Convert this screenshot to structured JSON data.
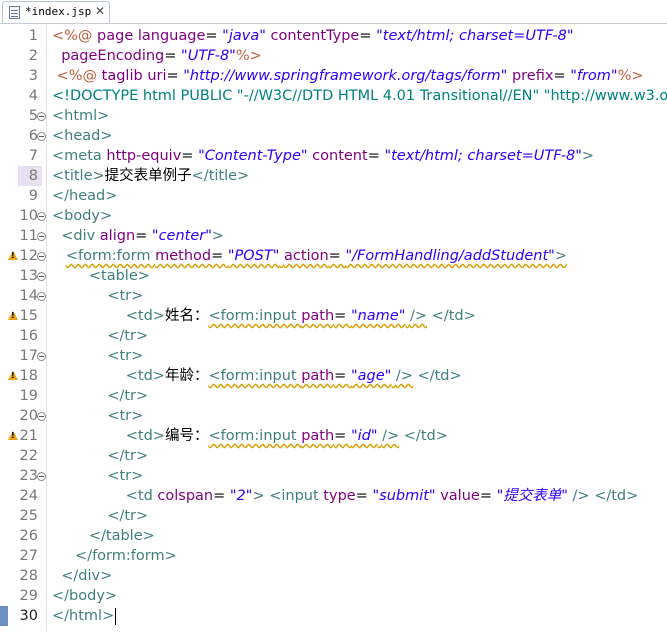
{
  "tab": {
    "title": "*index.jsp",
    "close": "✕",
    "icon": "jsp-file-icon"
  },
  "editor": {
    "current_line": 30,
    "fold_lines": [
      5,
      6,
      10,
      11,
      12,
      13,
      14,
      17,
      20,
      23
    ],
    "warning_lines": [
      12,
      15,
      18,
      21
    ],
    "highlight_lines": [
      8
    ],
    "bookmark_lines": [
      30
    ],
    "lines": [
      [
        [
          "jsp",
          "<%@ "
        ],
        [
          "attr",
          "page "
        ],
        [
          "attr",
          "language"
        ],
        [
          "text",
          "= "
        ],
        [
          "val",
          "\"java\""
        ],
        [
          "text",
          " "
        ],
        [
          "attr",
          "contentType"
        ],
        [
          "text",
          "= "
        ],
        [
          "val",
          "\"text/html; charset=UTF-8\""
        ]
      ],
      [
        [
          "text",
          "  "
        ],
        [
          "attr",
          "pageEncoding"
        ],
        [
          "text",
          "= "
        ],
        [
          "val",
          "\"UTF-8\""
        ],
        [
          "jsp",
          "%>"
        ]
      ],
      [
        [
          "jsp",
          " <%@ "
        ],
        [
          "attr",
          "taglib "
        ],
        [
          "attr",
          "uri"
        ],
        [
          "text",
          "= "
        ],
        [
          "val",
          "\"http://www.springframework.org/tags/form\""
        ],
        [
          "text",
          " "
        ],
        [
          "attr",
          "prefix"
        ],
        [
          "text",
          "= "
        ],
        [
          "val",
          "\"from\""
        ],
        [
          "jsp",
          "%>"
        ]
      ],
      [
        [
          "doc",
          "<!DOCTYPE html PUBLIC \"-//W3C//DTD HTML 4.01 Transitional//EN\" \"http://www.w3.or"
        ]
      ],
      [
        [
          "tag",
          "<html>"
        ]
      ],
      [
        [
          "tag",
          "<head>"
        ]
      ],
      [
        [
          "tag",
          "<meta "
        ],
        [
          "attr",
          "http-equiv"
        ],
        [
          "text",
          "= "
        ],
        [
          "val",
          "\"Content-Type\""
        ],
        [
          "text",
          " "
        ],
        [
          "attr",
          "content"
        ],
        [
          "text",
          "= "
        ],
        [
          "val",
          "\"text/html; charset=UTF-8\""
        ],
        [
          "tag",
          ">"
        ]
      ],
      [
        [
          "tag",
          "<title>"
        ],
        [
          "text",
          "提交表单例子"
        ],
        [
          "tag",
          "</title>"
        ]
      ],
      [
        [
          "tag",
          "</head>"
        ]
      ],
      [
        [
          "tag",
          "<body>"
        ]
      ],
      [
        [
          "text",
          "  "
        ],
        [
          "tag",
          "<div "
        ],
        [
          "attr",
          "align"
        ],
        [
          "text",
          "= "
        ],
        [
          "val",
          "\"center\""
        ],
        [
          "tag",
          ">"
        ]
      ],
      [
        [
          "text",
          "   "
        ],
        [
          "sq_tag",
          "<form:form "
        ],
        [
          "sq_attr",
          "method"
        ],
        [
          "sq_text",
          "= "
        ],
        [
          "sq_val",
          "\"POST\""
        ],
        [
          "sq_text",
          " "
        ],
        [
          "sq_attr",
          "action"
        ],
        [
          "sq_text",
          "= "
        ],
        [
          "sq_val",
          "\"/FormHandling/addStudent\""
        ],
        [
          "sq_tag",
          ">"
        ]
      ],
      [
        [
          "text",
          "        "
        ],
        [
          "tag",
          "<table>"
        ]
      ],
      [
        [
          "text",
          "            "
        ],
        [
          "tag",
          "<tr>"
        ]
      ],
      [
        [
          "text",
          "                "
        ],
        [
          "tag",
          "<td>"
        ],
        [
          "text",
          "姓名："
        ],
        [
          "sq_tag",
          "<form:input "
        ],
        [
          "sq_attr",
          "path"
        ],
        [
          "sq_text",
          "= "
        ],
        [
          "sq_val",
          "\"name\""
        ],
        [
          "sq_text",
          " "
        ],
        [
          "sq_tag",
          "/>"
        ],
        [
          "text",
          " "
        ],
        [
          "tag",
          "</td>"
        ]
      ],
      [
        [
          "text",
          "            "
        ],
        [
          "tag",
          "</tr>"
        ]
      ],
      [
        [
          "text",
          "            "
        ],
        [
          "tag",
          "<tr>"
        ]
      ],
      [
        [
          "text",
          "                "
        ],
        [
          "tag",
          "<td>"
        ],
        [
          "text",
          "年龄："
        ],
        [
          "sq_tag",
          "<form:input "
        ],
        [
          "sq_attr",
          "path"
        ],
        [
          "sq_text",
          "= "
        ],
        [
          "sq_val",
          "\"age\""
        ],
        [
          "sq_text",
          " "
        ],
        [
          "sq_tag",
          "/>"
        ],
        [
          "text",
          " "
        ],
        [
          "tag",
          "</td>"
        ]
      ],
      [
        [
          "text",
          "            "
        ],
        [
          "tag",
          "</tr>"
        ]
      ],
      [
        [
          "text",
          "            "
        ],
        [
          "tag",
          "<tr>"
        ]
      ],
      [
        [
          "text",
          "                "
        ],
        [
          "tag",
          "<td>"
        ],
        [
          "text",
          "编号："
        ],
        [
          "sq_tag",
          "<form:input "
        ],
        [
          "sq_attr",
          "path"
        ],
        [
          "sq_text",
          "= "
        ],
        [
          "sq_val",
          "\"id\""
        ],
        [
          "sq_text",
          " "
        ],
        [
          "sq_tag",
          "/>"
        ],
        [
          "text",
          " "
        ],
        [
          "tag",
          "</td>"
        ]
      ],
      [
        [
          "text",
          "            "
        ],
        [
          "tag",
          "</tr>"
        ]
      ],
      [
        [
          "text",
          "            "
        ],
        [
          "tag",
          "<tr>"
        ]
      ],
      [
        [
          "text",
          "                "
        ],
        [
          "tag",
          "<td "
        ],
        [
          "attr",
          "colspan"
        ],
        [
          "text",
          "= "
        ],
        [
          "val",
          "\"2\""
        ],
        [
          "tag",
          ">"
        ],
        [
          "text",
          " "
        ],
        [
          "tag",
          "<input "
        ],
        [
          "attr",
          "type"
        ],
        [
          "text",
          "= "
        ],
        [
          "val",
          "\"submit\""
        ],
        [
          "text",
          " "
        ],
        [
          "attr",
          "value"
        ],
        [
          "text",
          "= "
        ],
        [
          "val",
          "\"提交表单\""
        ],
        [
          "text",
          " "
        ],
        [
          "tag",
          "/>"
        ],
        [
          "text",
          " "
        ],
        [
          "tag",
          "</td>"
        ]
      ],
      [
        [
          "text",
          "            "
        ],
        [
          "tag",
          "</tr>"
        ]
      ],
      [
        [
          "text",
          "        "
        ],
        [
          "tag",
          "</table>"
        ]
      ],
      [
        [
          "text",
          "     "
        ],
        [
          "tag",
          "</form:form>"
        ]
      ],
      [
        [
          "text",
          "  "
        ],
        [
          "tag",
          "</div>"
        ]
      ],
      [
        [
          "tag",
          "</body>"
        ]
      ],
      [
        [
          "tag",
          "</html>"
        ]
      ]
    ]
  }
}
